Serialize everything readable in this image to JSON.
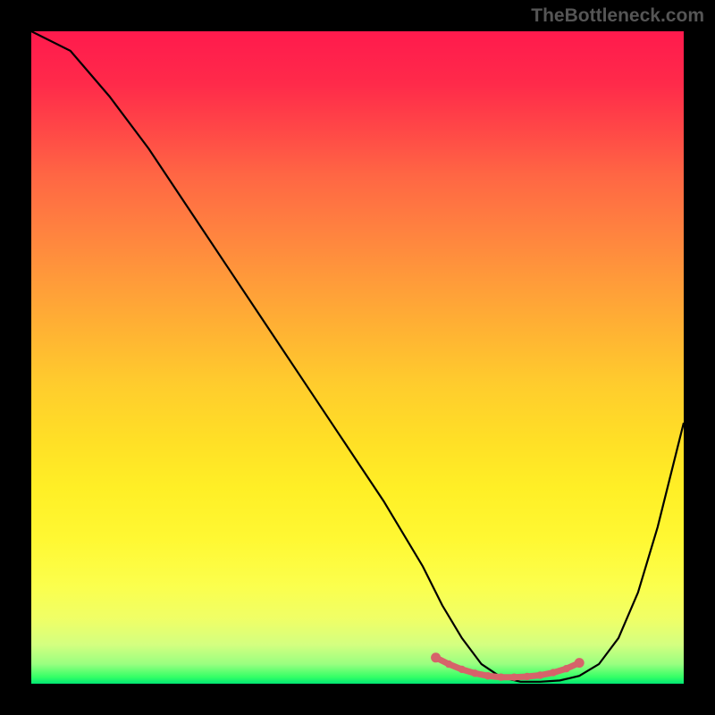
{
  "watermark": "TheBottleneck.com",
  "chart_data": {
    "type": "line",
    "title": "",
    "xlabel": "",
    "ylabel": "",
    "xlim": [
      0,
      100
    ],
    "ylim": [
      0,
      100
    ],
    "series": [
      {
        "name": "curve",
        "x": [
          0,
          6,
          12,
          18,
          24,
          30,
          36,
          42,
          48,
          54,
          60,
          63,
          66,
          69,
          72,
          75,
          78,
          81,
          84,
          87,
          90,
          93,
          96,
          100
        ],
        "values": [
          100,
          97,
          90,
          82,
          73,
          64,
          55,
          46,
          37,
          28,
          18,
          12,
          7,
          3,
          1,
          0.3,
          0.3,
          0.5,
          1.2,
          3,
          7,
          14,
          24,
          40
        ]
      },
      {
        "name": "marker-band",
        "x": [
          62,
          64,
          66,
          68,
          70,
          72,
          74,
          76,
          78,
          80,
          82,
          84
        ],
        "values": [
          4.0,
          3.0,
          2.2,
          1.6,
          1.2,
          1.0,
          1.0,
          1.1,
          1.3,
          1.7,
          2.3,
          3.2
        ]
      }
    ],
    "colors": {
      "curve": "#000000",
      "marker": "#d6636a"
    }
  }
}
